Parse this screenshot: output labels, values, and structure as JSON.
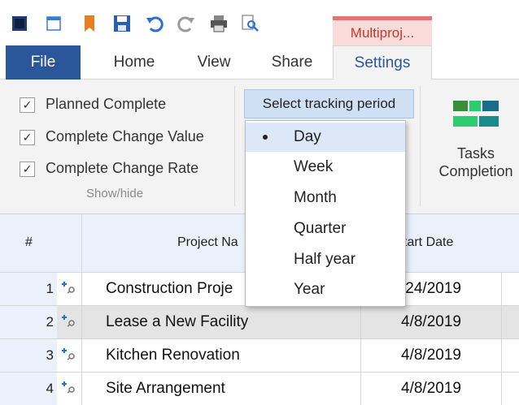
{
  "qat": {
    "icons": [
      "app-icon",
      "window-icon",
      "bookmark-icon",
      "save-icon",
      "undo-icon",
      "redo-icon",
      "print-icon",
      "print-preview-icon"
    ]
  },
  "context_tab": {
    "label": "Multiproj..."
  },
  "tabs": {
    "file": "File",
    "home": "Home",
    "view": "View",
    "share": "Share",
    "settings": "Settings"
  },
  "ribbon": {
    "checkboxes": [
      {
        "label": "Planned Complete",
        "checked": true
      },
      {
        "label": "Complete Change Value",
        "checked": true
      },
      {
        "label": "Complete Change Rate",
        "checked": true
      }
    ],
    "group_label": "Show/hide",
    "tracking_dropdown": "Select tracking period",
    "tasks_completion_label": "Tasks Completion",
    "colors": {
      "accent": "#2b579a",
      "green": "#2ecc71",
      "teal": "#1b8a8a"
    }
  },
  "menu": {
    "items": [
      "Day",
      "Week",
      "Month",
      "Quarter",
      "Half year",
      "Year"
    ],
    "selected": "Day"
  },
  "grid": {
    "headers": {
      "num": "#",
      "name": "Project Na",
      "start": "tart Date"
    },
    "rows": [
      {
        "num": "1",
        "name": "Construction Proje",
        "start": "/24/2019"
      },
      {
        "num": "2",
        "name": "Lease a New Facility",
        "start": "4/8/2019"
      },
      {
        "num": "3",
        "name": "Kitchen Renovation",
        "start": "4/8/2019"
      },
      {
        "num": "4",
        "name": "Site Arrangement",
        "start": "4/8/2019"
      }
    ]
  }
}
